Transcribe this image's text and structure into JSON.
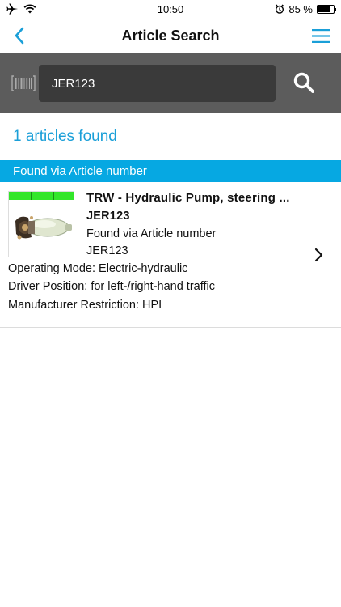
{
  "status_bar": {
    "time": "10:50",
    "battery_text": "85 %"
  },
  "nav": {
    "title": "Article Search"
  },
  "search": {
    "value": "JER123"
  },
  "results": {
    "count_text": "1 articles found",
    "section_header": "Found via Article number",
    "items": [
      {
        "title": "TRW - Hydraulic Pump, steering ...",
        "article_number": "JER123",
        "found_via": "Found via Article number",
        "match_value": "JER123",
        "attributes": [
          "Operating Mode: Electric-hydraulic",
          "Driver Position: for left-/right-hand traffic",
          "Manufacturer Restriction: HPI"
        ]
      }
    ]
  },
  "colors": {
    "accent": "#1a9fd8",
    "section_bg": "#06a8e2",
    "search_bar_bg": "#5c5c5c",
    "search_input_bg": "#3a3a3a"
  }
}
